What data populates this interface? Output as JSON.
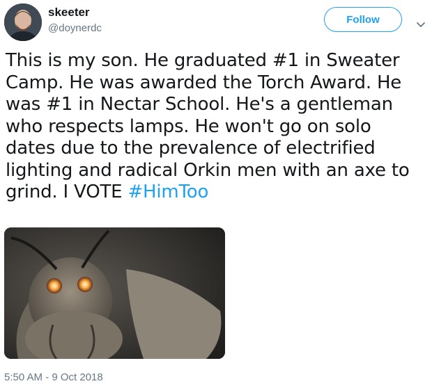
{
  "author": {
    "display_name": "skeeter",
    "handle": "@doynerdc",
    "avatar_icon": "user-avatar"
  },
  "follow_button": {
    "label": "Follow"
  },
  "menu": {
    "icon": "chevron-down-icon"
  },
  "tweet": {
    "lines": [
      "This is my son.  He graduated #1 in Sweater",
      "Camp. He was awarded the Torch Award. He",
      "was #1 in Nectar School. He's a gentleman",
      "who respects lamps. He won't go on solo",
      "dates due to the prevalence of electrified",
      "lighting and radical Orkin men with an axe to"
    ],
    "last_line_text": "grind. I VOTE ",
    "hashtag": "#HimToo",
    "media_description_icon": "moth-photo"
  },
  "timestamp": "5:50 AM - 9 Oct 2018",
  "colors": {
    "accent": "#1da1f2",
    "text": "#14171a",
    "secondary": "#657786"
  }
}
